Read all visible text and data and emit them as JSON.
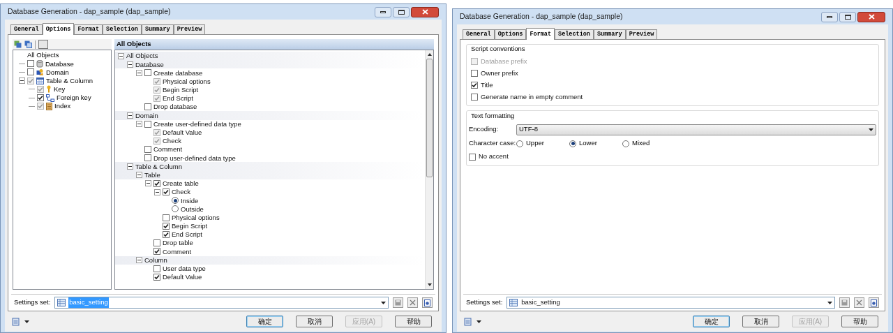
{
  "left_window": {
    "title": "Database Generation - dap_sample (dap_sample)",
    "tabs": [
      {
        "label": "General",
        "selected": false
      },
      {
        "label": "Options",
        "selected": true
      },
      {
        "label": "Format",
        "selected": false
      },
      {
        "label": "Selection",
        "selected": false
      },
      {
        "label": "Summary",
        "selected": false
      },
      {
        "label": "Preview",
        "selected": false
      }
    ],
    "object_tree": {
      "root": "All Objects",
      "items": [
        {
          "label": "Database",
          "checked": false,
          "disabled": false
        },
        {
          "label": "Domain",
          "checked": false,
          "disabled": false
        },
        {
          "label": "Table & Column",
          "checked": true,
          "disabled": true,
          "expanded": true,
          "children": [
            {
              "label": "Key",
              "checked": true,
              "disabled": true
            },
            {
              "label": "Foreign key",
              "checked": true,
              "disabled": false
            },
            {
              "label": "Index",
              "checked": true,
              "disabled": true
            }
          ]
        }
      ]
    },
    "options_header": "All Objects",
    "options_tree": [
      {
        "label": "All Objects",
        "kind": "group",
        "expanded": true,
        "children": [
          {
            "label": "Database",
            "kind": "group",
            "expanded": true,
            "children": [
              {
                "label": "Create database",
                "kind": "check",
                "checked": false,
                "disabled": false,
                "expanded": true,
                "children": [
                  {
                    "label": "Physical options",
                    "kind": "check",
                    "checked": true,
                    "disabled": true
                  },
                  {
                    "label": "Begin Script",
                    "kind": "check",
                    "checked": true,
                    "disabled": true
                  },
                  {
                    "label": "End Script",
                    "kind": "check",
                    "checked": true,
                    "disabled": true
                  }
                ]
              },
              {
                "label": "Drop database",
                "kind": "check",
                "checked": false,
                "disabled": false
              }
            ]
          },
          {
            "label": "Domain",
            "kind": "group",
            "expanded": true,
            "children": [
              {
                "label": "Create user-defined data type",
                "kind": "check",
                "checked": false,
                "disabled": false,
                "expanded": true,
                "children": [
                  {
                    "label": "Default Value",
                    "kind": "check",
                    "checked": true,
                    "disabled": true
                  },
                  {
                    "label": "Check",
                    "kind": "check",
                    "checked": true,
                    "disabled": true
                  }
                ]
              },
              {
                "label": "Comment",
                "kind": "check",
                "checked": false,
                "disabled": false
              },
              {
                "label": "Drop user-defined data type",
                "kind": "check",
                "checked": false,
                "disabled": false
              }
            ]
          },
          {
            "label": "Table & Column",
            "kind": "group",
            "expanded": true,
            "children": [
              {
                "label": "Table",
                "kind": "group",
                "expanded": true,
                "children": [
                  {
                    "label": "Create table",
                    "kind": "check",
                    "checked": true,
                    "disabled": false,
                    "expanded": true,
                    "children": [
                      {
                        "label": "Check",
                        "kind": "check",
                        "checked": true,
                        "disabled": false,
                        "expanded": true,
                        "children": [
                          {
                            "label": "Inside",
                            "kind": "radio",
                            "selected": true
                          },
                          {
                            "label": "Outside",
                            "kind": "radio",
                            "selected": false
                          }
                        ]
                      },
                      {
                        "label": "Physical options",
                        "kind": "check",
                        "checked": false,
                        "disabled": false
                      },
                      {
                        "label": "Begin Script",
                        "kind": "check",
                        "checked": true,
                        "disabled": false
                      },
                      {
                        "label": "End Script",
                        "kind": "check",
                        "checked": true,
                        "disabled": false
                      }
                    ]
                  },
                  {
                    "label": "Drop table",
                    "kind": "check",
                    "checked": false,
                    "disabled": false
                  },
                  {
                    "label": "Comment",
                    "kind": "check",
                    "checked": true,
                    "disabled": false
                  }
                ]
              },
              {
                "label": "Column",
                "kind": "group",
                "expanded": true,
                "children": [
                  {
                    "label": "User data type",
                    "kind": "check",
                    "checked": false,
                    "disabled": false
                  },
                  {
                    "label": "Default Value",
                    "kind": "check",
                    "checked": true,
                    "disabled": false
                  }
                ]
              }
            ]
          }
        ]
      }
    ],
    "settings": {
      "label": "Settings set:",
      "value": "basic_setting",
      "selected": true
    },
    "buttons": [
      {
        "label": "确定",
        "default": true,
        "disabled": false
      },
      {
        "label": "取消",
        "default": false,
        "disabled": false
      },
      {
        "label": "应用(A)",
        "default": false,
        "disabled": true
      },
      {
        "label": "帮助",
        "default": false,
        "disabled": false
      }
    ]
  },
  "right_window": {
    "title": "Database Generation - dap_sample (dap_sample)",
    "tabs": [
      {
        "label": "General",
        "selected": false
      },
      {
        "label": "Options",
        "selected": false
      },
      {
        "label": "Format",
        "selected": true
      },
      {
        "label": "Selection",
        "selected": false
      },
      {
        "label": "Summary",
        "selected": false
      },
      {
        "label": "Preview",
        "selected": false
      }
    ],
    "script_conventions": {
      "title": "Script conventions",
      "options": [
        {
          "label": "Database prefix",
          "checked": false,
          "disabled": true
        },
        {
          "label": "Owner prefix",
          "checked": false,
          "disabled": false
        },
        {
          "label": "Title",
          "checked": true,
          "disabled": false
        },
        {
          "label": "Generate name in empty comment",
          "checked": false,
          "disabled": false
        }
      ]
    },
    "text_formatting": {
      "title": "Text formatting",
      "encoding_label": "Encoding:",
      "encoding": "UTF-8",
      "case_label": "Character case:",
      "cases": [
        {
          "label": "Upper",
          "selected": false
        },
        {
          "label": "Lower",
          "selected": true
        },
        {
          "label": "Mixed",
          "selected": false
        }
      ],
      "no_accent": {
        "label": "No accent",
        "checked": false,
        "disabled": false
      }
    },
    "settings": {
      "label": "Settings set:",
      "value": "basic_setting",
      "selected": false
    },
    "buttons": [
      {
        "label": "确定",
        "default": true,
        "disabled": false
      },
      {
        "label": "取消",
        "default": false,
        "disabled": false
      },
      {
        "label": "应用(A)",
        "default": false,
        "disabled": true
      },
      {
        "label": "帮助",
        "default": false,
        "disabled": false
      }
    ]
  }
}
